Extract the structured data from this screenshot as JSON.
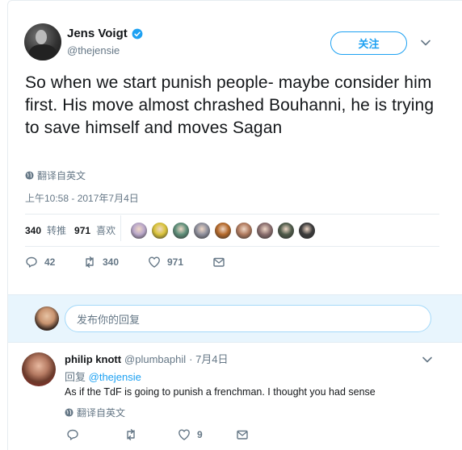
{
  "tweet": {
    "display_name": "Jens Voigt",
    "handle": "@thejensie",
    "follow_label": "关注",
    "text": "So when we start punish people- maybe consider him first. His move almost chrashed Bouhanni, he is trying to save himself and moves Sagan",
    "translate_label": "翻译自英文",
    "timestamp": "上午10:58 - 2017年7月4日",
    "retweet_count": "340",
    "retweet_label": "转推",
    "like_count": "971",
    "like_label": "喜欢",
    "actions": {
      "reply_count": "42",
      "retweet_count": "340",
      "like_count": "971"
    },
    "liker_colors": [
      "#b9a7c9",
      "#d9c33a",
      "#5e8f7a",
      "#8e8f9c",
      "#b4692b",
      "#b07a5e",
      "#8a6e6e",
      "#4f5b4a",
      "#3b3b3b"
    ]
  },
  "reply_box": {
    "placeholder": "发布你的回复"
  },
  "reply": {
    "display_name": "philip knott",
    "handle": "@plumbaphil",
    "date": "· 7月4日",
    "replying_to_prefix": "回复",
    "replying_to": "@thejensie",
    "text": "As if the TdF is going to punish a frenchman. I thought you had sense",
    "translate_label": "翻译自英文",
    "actions": {
      "like_count": "9"
    }
  },
  "colors": {
    "accent": "#1da1f2",
    "secondary_text": "#657786",
    "reply_bar_bg": "#e8f5fd"
  }
}
